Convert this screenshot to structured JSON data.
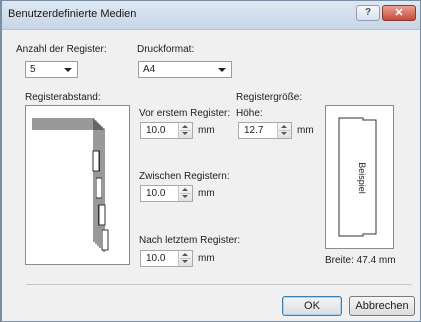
{
  "window": {
    "title": "Benutzerdefinierte Medien",
    "help_label": "?",
    "close_label": "✕"
  },
  "tab_count": {
    "label": "Anzahl der Register:",
    "value": "5"
  },
  "print_format": {
    "label": "Druckformat:",
    "value": "A4"
  },
  "tab_spacing": {
    "label": "Registerabstand:"
  },
  "before_first": {
    "label": "Vor erstem Register:",
    "value": "10.0",
    "unit": "mm"
  },
  "between": {
    "label": "Zwischen Registern:",
    "value": "10.0",
    "unit": "mm"
  },
  "after_last": {
    "label": "Nach letztem Register:",
    "value": "10.0",
    "unit": "mm"
  },
  "tab_size": {
    "label": "Registergröße:",
    "height_label": "Höhe:",
    "height_value": "12.7",
    "unit": "mm",
    "sample_label": "Beispiel",
    "width_text": "Breite: 47.4 mm"
  },
  "buttons": {
    "ok": "OK",
    "cancel": "Abbrechen"
  }
}
